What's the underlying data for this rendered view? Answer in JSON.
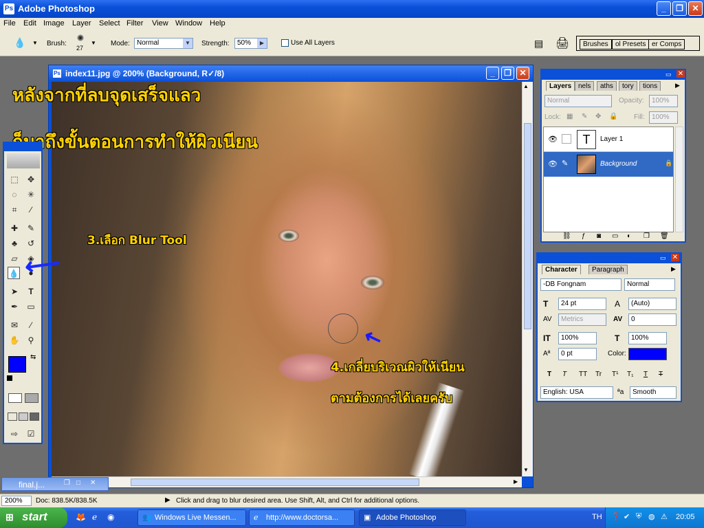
{
  "app": {
    "title": "Adobe Photoshop",
    "icon": "photoshop-icon"
  },
  "menu": [
    "File",
    "Edit",
    "Image",
    "Layer",
    "Select",
    "Filter",
    "View",
    "Window",
    "Help"
  ],
  "options": {
    "brush_label": "Brush:",
    "brush_size": "27",
    "mode_label": "Mode:",
    "mode_value": "Normal",
    "strength_label": "Strength:",
    "strength_value": "50%",
    "use_all_layers_label": "Use All Layers",
    "tabs": [
      "Brushes",
      "ol Presets",
      "er Comps"
    ]
  },
  "document": {
    "title": "index11.jpg @ 200% (Background, R✓/8)"
  },
  "annotations": {
    "line1": "หลังจากที่ลบจุดเสร็จแลว",
    "line2": "ก็มาถึงขั้นตอนการทำให้ผิวเนียน",
    "step3": "3.เลือก  Blur Tool",
    "step4a": "4.เกลี่ยบริเวณผิวให้เนียน",
    "step4b": "ตามต้องการได้เลยครับ"
  },
  "layers_panel": {
    "tabs": [
      "Layers",
      "nels",
      "aths",
      "tory",
      "tions"
    ],
    "blend_mode": "Normal",
    "opacity_label": "Opacity:",
    "opacity_value": "100%",
    "lock_label": "Lock:",
    "fill_label": "Fill:",
    "fill_value": "100%",
    "layers": [
      {
        "name": "Layer 1",
        "thumb": "T",
        "selected": false
      },
      {
        "name": "Background",
        "selected": true
      }
    ]
  },
  "character_panel": {
    "tabs": [
      "Character",
      "Paragraph"
    ],
    "font_family": "-DB Fongnam",
    "font_style": "Normal",
    "font_size": "24 pt",
    "leading": "(Auto)",
    "kerning": "Metrics",
    "tracking": "0",
    "vscale": "100%",
    "hscale": "100%",
    "baseline": "0 pt",
    "color_label": "Color:",
    "color_value": "#0000ff",
    "style_buttons": [
      "T",
      "T",
      "TT",
      "Tr",
      "T¹",
      "T₁",
      "T",
      "T"
    ],
    "language": "English: USA",
    "aa_label": "ªa",
    "antialias": "Smooth"
  },
  "minimized_doc": {
    "title": "final.j..."
  },
  "status": {
    "zoom": "200%",
    "doc_info": "Doc: 838.5K/838.5K",
    "hint": "Click and drag to blur desired area.  Use Shift, Alt, and Ctrl for additional options."
  },
  "taskbar": {
    "start_label": "start",
    "tasks": [
      {
        "label": "Windows Live Messen...",
        "active": false
      },
      {
        "label": "http://www.doctorsa...",
        "active": false
      },
      {
        "label": "Adobe Photoshop",
        "active": true
      }
    ],
    "language": "TH",
    "clock": "20:05"
  },
  "colors": {
    "foreground": "#0000ff",
    "background": "#ffffff",
    "accent": "#0a50d8"
  }
}
